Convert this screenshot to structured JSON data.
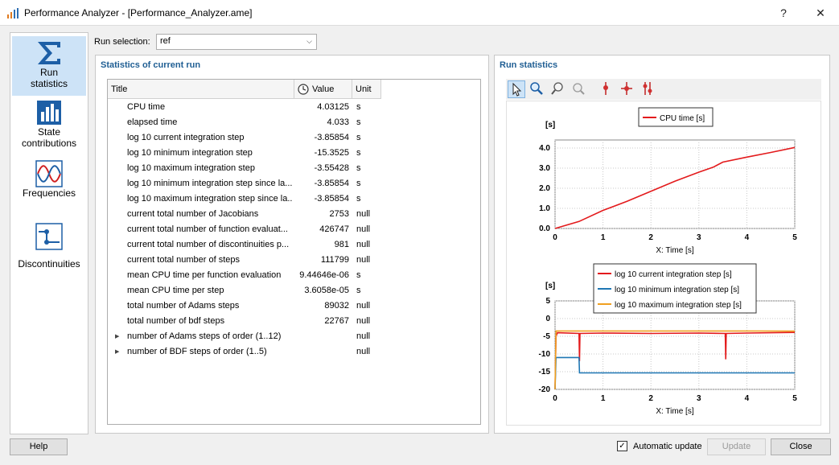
{
  "window": {
    "title": "Performance Analyzer - [Performance_Analyzer.ame]",
    "help_glyph": "?",
    "close_glyph": "✕"
  },
  "sidebar": {
    "items": [
      {
        "label_line1": "Run",
        "label_line2": "statistics",
        "icon": "sigma-icon",
        "active": true
      },
      {
        "label_line1": "State",
        "label_line2": "contributions",
        "icon": "bar-chart-icon"
      },
      {
        "label_line1": "Frequencies",
        "label_line2": "",
        "icon": "wave-icon"
      },
      {
        "label_line1": "Discontinuities",
        "label_line2": "",
        "icon": "discontinuity-icon"
      }
    ]
  },
  "run_selection": {
    "label": "Run selection:",
    "value": "ref"
  },
  "stats_panel": {
    "title": "Statistics of current run",
    "columns": {
      "title": "Title",
      "value": "Value",
      "unit": "Unit"
    },
    "rows": [
      {
        "title": "CPU time",
        "value": "4.03125",
        "unit": "s"
      },
      {
        "title": "elapsed time",
        "value": "4.033",
        "unit": "s"
      },
      {
        "title": "log 10 current integration step",
        "value": "-3.85854",
        "unit": "s"
      },
      {
        "title": "log 10 minimum integration step",
        "value": "-15.3525",
        "unit": "s"
      },
      {
        "title": "log 10 maximum integration step",
        "value": "-3.55428",
        "unit": "s"
      },
      {
        "title": "log 10 minimum integration step since la...",
        "value": "-3.85854",
        "unit": "s"
      },
      {
        "title": "log 10 maximum integration step since la...",
        "value": "-3.85854",
        "unit": "s"
      },
      {
        "title": "current total number of Jacobians",
        "value": "2753",
        "unit": "null"
      },
      {
        "title": "current total number of function evaluat...",
        "value": "426747",
        "unit": "null"
      },
      {
        "title": "current total number of discontinuities p...",
        "value": "981",
        "unit": "null"
      },
      {
        "title": "current total number of steps",
        "value": "111799",
        "unit": "null"
      },
      {
        "title": "mean CPU time per function evaluation",
        "value": "9.44646e-06",
        "unit": "s"
      },
      {
        "title": "mean CPU time per step",
        "value": "3.6058e-05",
        "unit": "s"
      },
      {
        "title": "total number of Adams steps",
        "value": "89032",
        "unit": "null"
      },
      {
        "title": "total number of bdf steps",
        "value": "22767",
        "unit": "null"
      },
      {
        "title": "number of Adams steps of order (1..12)",
        "value": "",
        "unit": "null",
        "expandable": true
      },
      {
        "title": "number of BDF steps of order (1..5)",
        "value": "",
        "unit": "null",
        "expandable": true
      }
    ]
  },
  "run_stats_panel": {
    "title": "Run statistics"
  },
  "toolbar": {
    "tools": [
      "pointer-icon",
      "zoom-in-icon",
      "zoom-out-icon",
      "zoom-reset-icon",
      "marker-icon",
      "marker-cross-icon",
      "marker-split-icon"
    ]
  },
  "chart_data": [
    {
      "type": "line",
      "title": "",
      "ylabel": "[s]",
      "xlabel": "X: Time [s]",
      "xlim": [
        0,
        5
      ],
      "ylim": [
        0,
        4.4
      ],
      "xticks": [
        "0",
        "1",
        "2",
        "3",
        "4",
        "5"
      ],
      "yticks": [
        "0.0",
        "1.0",
        "2.0",
        "3.0",
        "4.0"
      ],
      "legend_position": "top-center",
      "series": [
        {
          "name": "CPU time [s]",
          "color": "#e31a1c",
          "x": [
            0,
            0.5,
            1,
            1.5,
            2,
            2.5,
            3,
            3.3,
            3.5,
            4,
            4.5,
            5
          ],
          "y": [
            0,
            0.35,
            0.9,
            1.35,
            1.85,
            2.35,
            2.8,
            3.05,
            3.3,
            3.55,
            3.78,
            4.03
          ]
        }
      ]
    },
    {
      "type": "line",
      "title": "",
      "ylabel": "[s]",
      "xlabel": "X: Time [s]",
      "xlim": [
        0,
        5
      ],
      "ylim": [
        -20,
        5
      ],
      "xticks": [
        "0",
        "1",
        "2",
        "3",
        "4",
        "5"
      ],
      "yticks": [
        "5",
        "0",
        "-5",
        "-10",
        "-15",
        "-20"
      ],
      "legend_position": "top-center",
      "series": [
        {
          "name": "log 10 current integration step [s]",
          "color": "#e31a1c",
          "x": [
            0,
            0.02,
            0.05,
            0.5,
            0.51,
            0.52,
            1,
            2,
            3,
            3.55,
            3.56,
            3.57,
            4,
            5
          ],
          "y": [
            -20,
            -5,
            -4,
            -4.2,
            -12,
            -4.2,
            -4.1,
            -4.2,
            -4.1,
            -4.2,
            -11.5,
            -4.2,
            -4.1,
            -3.9
          ]
        },
        {
          "name": "log 10 minimum integration step [s]",
          "color": "#1f77b4",
          "x": [
            0,
            0.02,
            0.5,
            0.51,
            5
          ],
          "y": [
            -20,
            -11,
            -11,
            -15.35,
            -15.35
          ]
        },
        {
          "name": "log 10 maximum integration step [s]",
          "color": "#f0a020",
          "x": [
            0,
            0.02,
            1,
            2,
            3,
            4,
            5
          ],
          "y": [
            -20,
            -3.5,
            -3.5,
            -3.5,
            -3.5,
            -3.5,
            -3.55
          ]
        }
      ]
    }
  ],
  "footer": {
    "help_label": "Help",
    "auto_update_label": "Automatic update",
    "auto_update_checked": true,
    "update_label": "Update",
    "close_label": "Close"
  }
}
